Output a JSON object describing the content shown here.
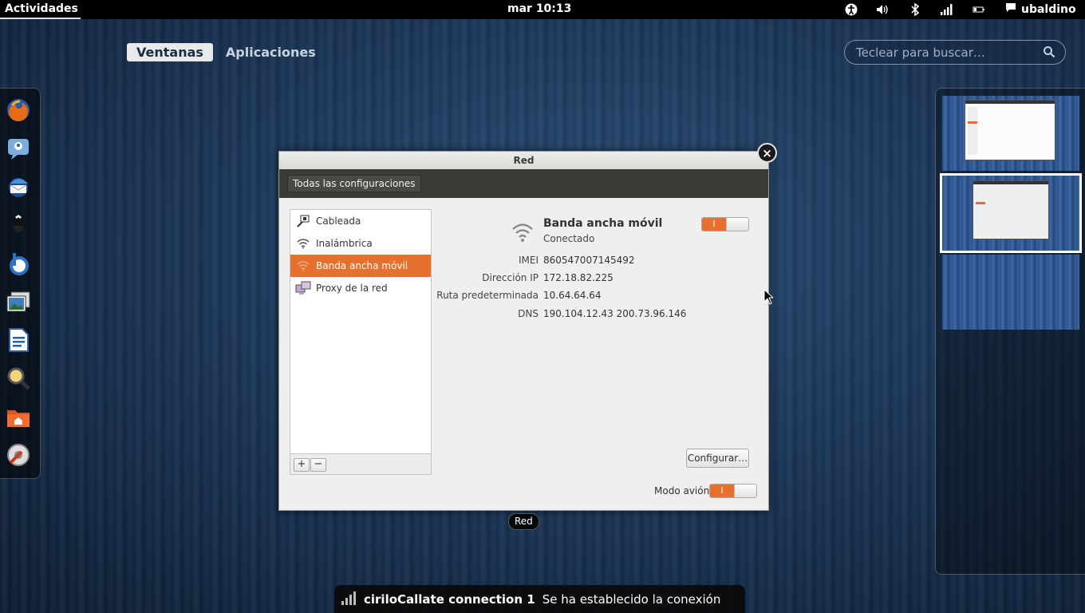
{
  "topbar": {
    "activities": "Actividades",
    "clock": "mar 10:13",
    "user": "ubaldino",
    "tray_icons": [
      "accessibility-icon",
      "volume-icon",
      "bluetooth-icon",
      "signal-icon",
      "battery-icon",
      "chat-icon"
    ]
  },
  "overview": {
    "tabs": [
      {
        "label": "Ventanas",
        "active": true
      },
      {
        "label": "Aplicaciones",
        "active": false
      }
    ],
    "search_placeholder": "Teclear para buscar…"
  },
  "dash": {
    "apps": [
      "firefox-icon",
      "empathy-icon",
      "thunderbird-icon",
      "inkscape-icon",
      "banshee-icon",
      "shotwell-icon",
      "writer-icon",
      "search-tool-icon",
      "home-folder-icon",
      "settings-icon"
    ]
  },
  "window": {
    "title": "Red",
    "caption": "Red",
    "all_settings": "Todas las configuraciones",
    "connections": [
      {
        "label": "Cableada",
        "icon": "wired-icon",
        "selected": false
      },
      {
        "label": "Inalámbrica",
        "icon": "wifi-icon",
        "selected": false
      },
      {
        "label": "Banda ancha móvil",
        "icon": "mobile-broadband-icon",
        "selected": true
      },
      {
        "label": "Proxy de la red",
        "icon": "proxy-icon",
        "selected": false
      }
    ],
    "add_label": "+",
    "remove_label": "−",
    "detail": {
      "name": "Banda ancha móvil",
      "status": "Conectado",
      "enabled": true,
      "toggle_on_label": "I",
      "fields": [
        {
          "label": "IMEI",
          "value": "860547007145492"
        },
        {
          "label": "Dirección IP",
          "value": "172.18.82.225"
        },
        {
          "label": "Ruta predeterminada",
          "value": "10.64.64.64"
        },
        {
          "label": "DNS",
          "value": "190.104.12.43 200.73.96.146"
        }
      ],
      "configure": "Configurar…"
    },
    "airplane_label": "Modo avión",
    "airplane_toggle_label": "I"
  },
  "notification": {
    "title": "ciriloCallate connection 1",
    "body": "Se ha establecido la conexión"
  },
  "colors": {
    "accent": "#e8702f",
    "toolbar": "#3c3b37"
  }
}
